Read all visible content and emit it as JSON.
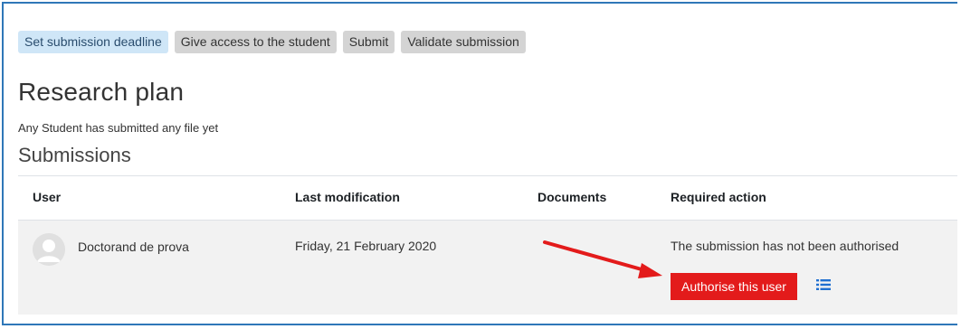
{
  "toolbar": {
    "set_deadline": "Set submission deadline",
    "give_access": "Give access to the student",
    "submit": "Submit",
    "validate": "Validate submission"
  },
  "page": {
    "title": "Research plan",
    "status_message": "Any Student has submitted any file yet",
    "section_title": "Submissions"
  },
  "table": {
    "headers": [
      "User",
      "Last modification",
      "Documents",
      "Required action"
    ],
    "rows": [
      {
        "user": "Doctorand de prova",
        "last_modification": "Friday, 21 February 2020",
        "documents": "",
        "required_action": "The submission has not been authorised",
        "action_button": "Authorise this user"
      }
    ]
  },
  "icons": {
    "avatar": "user-avatar-icon",
    "list": "list-icon",
    "annotation": "red-arrow-annotation"
  },
  "colors": {
    "accent_blue": "#2f77b8",
    "primary_button_bg": "#cfe6f7",
    "action_button_bg": "#e31b1b",
    "list_icon": "#1f6fd1"
  }
}
